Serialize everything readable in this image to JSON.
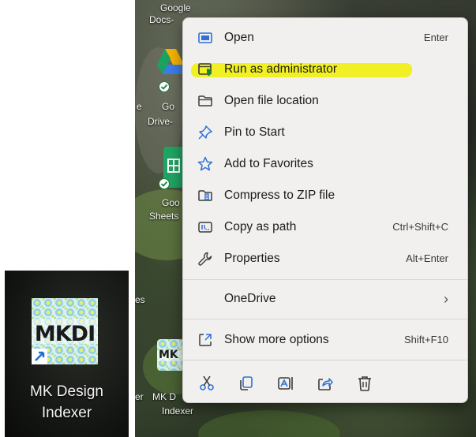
{
  "inset": {
    "icon_text": "MKDI",
    "label_line1": "MK Design",
    "label_line2": "Indexer"
  },
  "desktop": {
    "google_docs_line1": "Google",
    "google_docs_line2": "Docs-",
    "google_drive_line1": "Go",
    "google_drive_line2": "Drive-",
    "google_sheets_line1": "Goo",
    "google_sheets_line2": "Sheets",
    "frag_e": "e",
    "frag_es": "es",
    "frag_er": "er",
    "mkdi_tile_text": "MK",
    "mkdi_label_line1": "MK D",
    "mkdi_label_line2": "Indexer"
  },
  "context_menu": {
    "items": [
      {
        "label": "Open",
        "shortcut": "Enter",
        "icon": "window-icon"
      },
      {
        "label": "Run as administrator",
        "shortcut": "",
        "icon": "shield-window-icon"
      },
      {
        "label": "Open file location",
        "shortcut": "",
        "icon": "folder-icon"
      },
      {
        "label": "Pin to Start",
        "shortcut": "",
        "icon": "pin-icon"
      },
      {
        "label": "Add to Favorites",
        "shortcut": "",
        "icon": "star-icon"
      },
      {
        "label": "Compress to ZIP file",
        "shortcut": "",
        "icon": "zip-folder-icon"
      },
      {
        "label": "Copy as path",
        "shortcut": "Ctrl+Shift+C",
        "icon": "copy-path-icon"
      },
      {
        "label": "Properties",
        "shortcut": "Alt+Enter",
        "icon": "wrench-icon"
      }
    ],
    "onedrive": {
      "label": "OneDrive",
      "arrow": "›"
    },
    "show_more": {
      "label": "Show more options",
      "shortcut": "Shift+F10",
      "icon": "expand-icon"
    },
    "bottom_actions": [
      "cut-icon",
      "copy-icon",
      "rename-icon",
      "share-icon",
      "delete-icon"
    ],
    "accent_color": "#2f6fd6",
    "highlight_color": "#f0f000"
  }
}
